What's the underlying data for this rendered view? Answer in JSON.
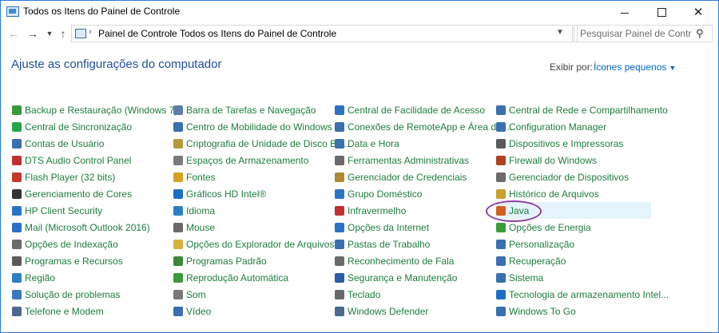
{
  "window": {
    "title": "Todos os Itens do Painel de Controle"
  },
  "address": {
    "crumbs": [
      "Painel de Controle",
      "Todos os Itens do Painel de Controle"
    ]
  },
  "search": {
    "placeholder": "Pesquisar Painel de Controle"
  },
  "header": {
    "title": "Ajuste as configurações do computador",
    "view_by_label": "Exibir por:",
    "view_by_value": "Ícones pequenos"
  },
  "colors": {
    "link_green": "#1e7d3e",
    "heading_blue": "#1e4f9c",
    "highlight": "#e5f3fb",
    "annotation_circle": "#8d3fa6"
  },
  "columns": [
    [
      {
        "label": "Backup e Restauração (Windows 7)",
        "icon": "backup-icon",
        "color": "#3a9a3a"
      },
      {
        "label": "Central de Sincronização",
        "icon": "sync-icon",
        "color": "#2aa34a"
      },
      {
        "label": "Contas de Usuário",
        "icon": "users-icon",
        "color": "#3a6fb0"
      },
      {
        "label": "DTS Audio Control Panel",
        "icon": "dts-icon",
        "color": "#c03030"
      },
      {
        "label": "Flash Player (32 bits)",
        "icon": "flash-icon",
        "color": "#c0392b"
      },
      {
        "label": "Gerenciamento de Cores",
        "icon": "color-management-icon",
        "color": "#333333"
      },
      {
        "label": "HP Client Security",
        "icon": "shield-icon",
        "color": "#2a72c6"
      },
      {
        "label": "Mail (Microsoft Outlook 2016)",
        "icon": "mail-icon",
        "color": "#2b6fc2"
      },
      {
        "label": "Opções de Indexação",
        "icon": "indexing-icon",
        "color": "#6b6b6b"
      },
      {
        "label": "Programas e Recursos",
        "icon": "programs-icon",
        "color": "#5a5a5a"
      },
      {
        "label": "Região",
        "icon": "globe-icon",
        "color": "#2d7fc1"
      },
      {
        "label": "Solução de problemas",
        "icon": "troubleshoot-icon",
        "color": "#3a78c0"
      },
      {
        "label": "Telefone e Modem",
        "icon": "phone-icon",
        "color": "#4a6a90"
      }
    ],
    [
      {
        "label": "Barra de Tarefas e Navegação",
        "icon": "taskbar-icon",
        "color": "#5b7fa8"
      },
      {
        "label": "Centro de Mobilidade do Windows",
        "icon": "mobility-icon",
        "color": "#3a6fb0"
      },
      {
        "label": "Criptografia de Unidade de Disco Bit...",
        "icon": "bitlocker-icon",
        "color": "#b89a3a"
      },
      {
        "label": "Espaços de Armazenamento",
        "icon": "storage-icon",
        "color": "#7a7a7a"
      },
      {
        "label": "Fontes",
        "icon": "fonts-icon",
        "color": "#d6a21e"
      },
      {
        "label": "Gráficos HD Intel®",
        "icon": "intel-icon",
        "color": "#1b6fc2"
      },
      {
        "label": "Idioma",
        "icon": "language-icon",
        "color": "#2d7fc1"
      },
      {
        "label": "Mouse",
        "icon": "mouse-icon",
        "color": "#6a6a6a"
      },
      {
        "label": "Opções do Explorador de Arquivos",
        "icon": "folder-options-icon",
        "color": "#d8b040"
      },
      {
        "label": "Programas Padrão",
        "icon": "default-programs-icon",
        "color": "#3a8a3a"
      },
      {
        "label": "Reprodução Automática",
        "icon": "autoplay-icon",
        "color": "#3a9a3a"
      },
      {
        "label": "Som",
        "icon": "sound-icon",
        "color": "#7a7a7a"
      },
      {
        "label": "Vídeo",
        "icon": "display-icon",
        "color": "#3a6fb0"
      }
    ],
    [
      {
        "label": "Central de Facilidade de Acesso",
        "icon": "ease-of-access-icon",
        "color": "#2a72c6"
      },
      {
        "label": "Conexões de RemoteApp e Área de ...",
        "icon": "remoteapp-icon",
        "color": "#3a6fb0"
      },
      {
        "label": "Data e Hora",
        "icon": "clock-icon",
        "color": "#3a6fb0"
      },
      {
        "label": "Ferramentas Administrativas",
        "icon": "admin-tools-icon",
        "color": "#6a6a6a"
      },
      {
        "label": "Gerenciador de Credenciais",
        "icon": "credentials-icon",
        "color": "#b08a30"
      },
      {
        "label": "Grupo Doméstico",
        "icon": "homegroup-icon",
        "color": "#2a72c6"
      },
      {
        "label": "Infravermelho",
        "icon": "infrared-icon",
        "color": "#c03030"
      },
      {
        "label": "Opções da Internet",
        "icon": "internet-options-icon",
        "color": "#2a72c6"
      },
      {
        "label": "Pastas de Trabalho",
        "icon": "work-folders-icon",
        "color": "#3a6fb0"
      },
      {
        "label": "Reconhecimento de Fala",
        "icon": "microphone-icon",
        "color": "#6a6a6a"
      },
      {
        "label": "Segurança e Manutenção",
        "icon": "flag-icon",
        "color": "#2a5aa8"
      },
      {
        "label": "Teclado",
        "icon": "keyboard-icon",
        "color": "#6a6a6a"
      },
      {
        "label": "Windows Defender",
        "icon": "defender-icon",
        "color": "#4a6a90"
      }
    ],
    [
      {
        "label": "Central de Rede e Compartilhamento",
        "icon": "network-icon",
        "color": "#3a6fb0"
      },
      {
        "label": "Configuration Manager",
        "icon": "config-manager-icon",
        "color": "#3a6fb0"
      },
      {
        "label": "Dispositivos e Impressoras",
        "icon": "printer-icon",
        "color": "#5a5a5a"
      },
      {
        "label": "Firewall do Windows",
        "icon": "firewall-icon",
        "color": "#b04020"
      },
      {
        "label": "Gerenciador de Dispositivos",
        "icon": "device-manager-icon",
        "color": "#6a6a6a"
      },
      {
        "label": "Histórico de Arquivos",
        "icon": "file-history-icon",
        "color": "#c8a030"
      },
      {
        "label": "Java",
        "icon": "java-icon",
        "color": "#d06020"
      },
      {
        "label": "Opções de Energia",
        "icon": "power-icon",
        "color": "#3a9a3a"
      },
      {
        "label": "Personalização",
        "icon": "personalization-icon",
        "color": "#3a6fb0"
      },
      {
        "label": "Recuperação",
        "icon": "recovery-icon",
        "color": "#3a6fb0"
      },
      {
        "label": "Sistema",
        "icon": "system-icon",
        "color": "#3a6fb0"
      },
      {
        "label": "Tecnologia de armazenamento Intel...",
        "icon": "intel-storage-icon",
        "color": "#1b6fc2"
      },
      {
        "label": "Windows To Go",
        "icon": "windows-to-go-icon",
        "color": "#3a6fb0"
      }
    ]
  ],
  "highlighted_item": "Java"
}
